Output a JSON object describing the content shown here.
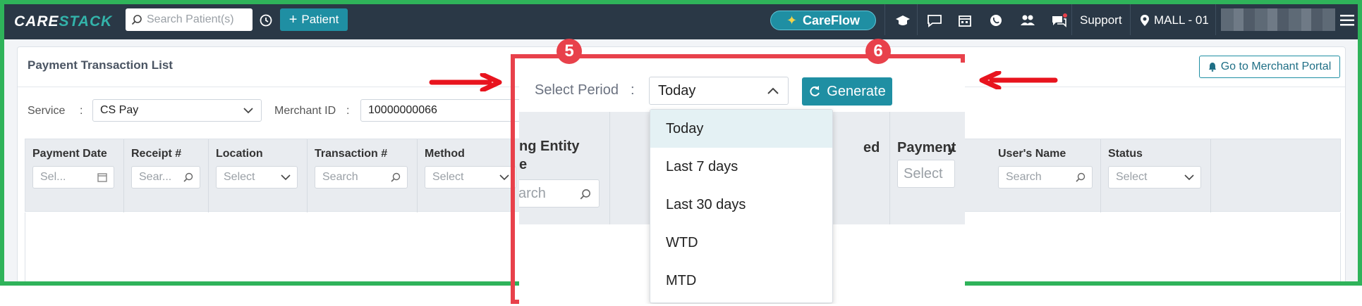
{
  "header": {
    "logo_part1": "CARE",
    "logo_part2": "STACK",
    "search_placeholder": "Search Patient(s)",
    "add_patient_label": "Patient",
    "careflow_label": "CareFlow",
    "support_label": "Support",
    "location_label": "MALL - 01"
  },
  "card": {
    "title": "Payment Transaction List",
    "merchant_portal_label": "Go to Merchant Portal",
    "service_label": "Service",
    "service_colon": ":",
    "service_value": "CS Pay",
    "merchant_id_label": "Merchant ID",
    "merchant_id_colon": ":",
    "merchant_id_value": "10000000066"
  },
  "grid": {
    "columns": [
      {
        "label": "Payment Date",
        "filter": "Sel..."
      },
      {
        "label": "Receipt #",
        "filter": "Sear..."
      },
      {
        "label": "Location",
        "filter": "Select"
      },
      {
        "label": "Transaction #",
        "filter": "Search"
      },
      {
        "label": "Method",
        "filter": "Select"
      },
      {
        "label": "User's Name",
        "filter": "Search"
      },
      {
        "label": "Status",
        "filter": "Select"
      }
    ]
  },
  "overlay": {
    "peek_entity_line1": "ng Entity",
    "peek_entity_line2": "e",
    "peek_entity_filter": "arch",
    "peek_ed": "ed",
    "peek_payment": "Payment",
    "peek_payment_suffix": "y",
    "peek_payment_filter": "Select",
    "select_period_label": "Select Period",
    "select_period_colon": ":",
    "selected_period": "Today",
    "generate_label": "Generate",
    "period_options": [
      "Today",
      "Last 7 days",
      "Last 30 days",
      "WTD",
      "MTD"
    ]
  },
  "callouts": {
    "step_5": "5",
    "step_6": "6"
  },
  "colors": {
    "header_bg": "#2a3846",
    "accent": "#1f8fa3",
    "frame_green": "#2fb35a",
    "highlight_red": "#e8414b"
  }
}
